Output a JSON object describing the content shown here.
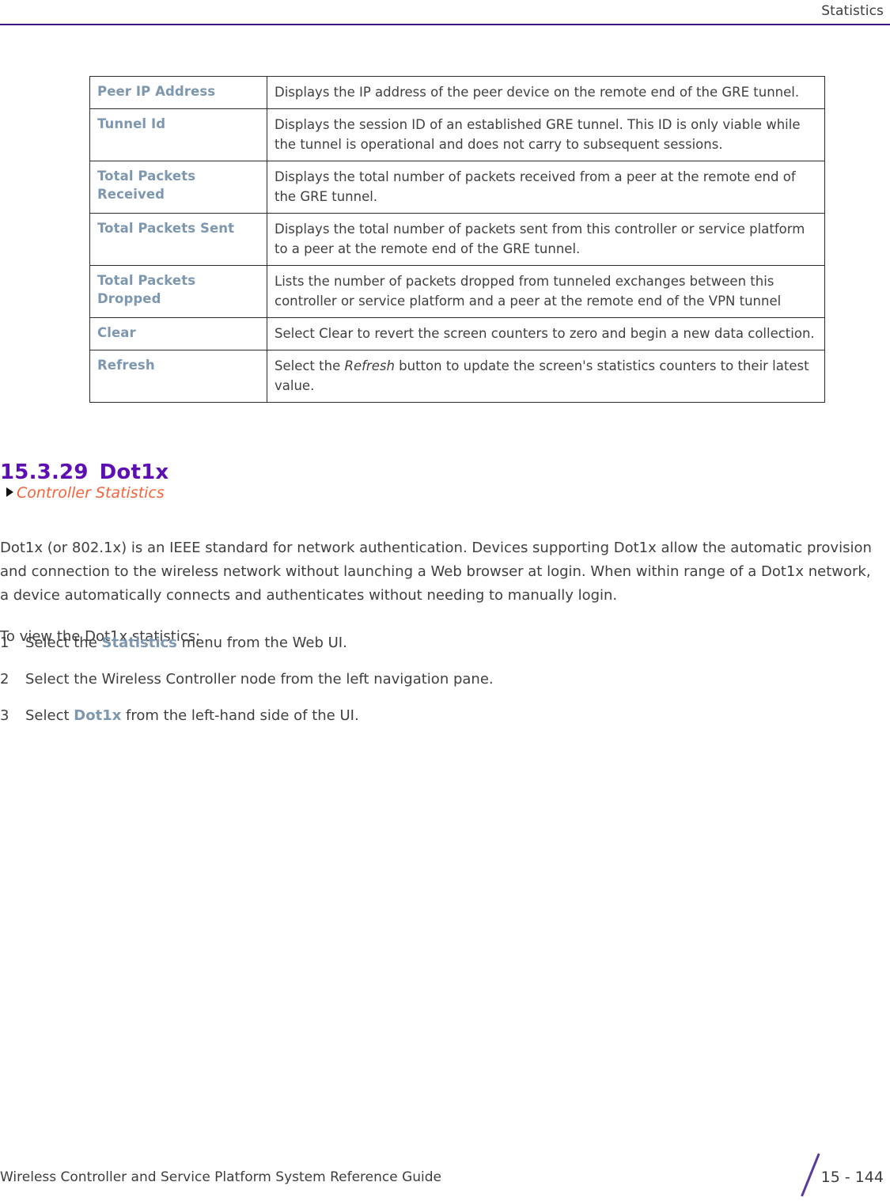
{
  "header": {
    "title": "Statistics",
    "rule_color": "#3c0f80"
  },
  "table": {
    "rows": [
      {
        "label": "Peer IP Address",
        "description": "Displays the IP address of the peer device on the remote end of the GRE tunnel."
      },
      {
        "label": "Tunnel Id",
        "description": "Displays the session ID of an established GRE tunnel. This ID is only viable while the tunnel is operational and does not carry to subsequent sessions."
      },
      {
        "label": "Total Packets Received",
        "description": "Displays the total number of packets received from a peer at the remote end of the GRE tunnel."
      },
      {
        "label": "Total Packets Sent",
        "description": "Displays the total number of packets sent from this controller or service platform to a peer at the remote end of the GRE tunnel."
      },
      {
        "label": "Total Packets Dropped",
        "description": "Lists the number of packets dropped from tunneled exchanges between this controller or service platform and a peer at the remote end of the VPN tunnel"
      },
      {
        "label": "Clear",
        "description": "Select Clear to revert the screen counters to zero and begin a new data collection."
      },
      {
        "label": "Refresh",
        "description_before": "Select the ",
        "description_italic": "Refresh",
        "description_after": " button to update the screen's statistics counters to their latest value."
      }
    ],
    "label_color": "#7d97b0"
  },
  "section": {
    "number": "15.3.29",
    "title": "Dot1x",
    "heading_color": "#5d0fb4"
  },
  "crossref": {
    "bullet_icon": "right-triangle-icon",
    "label": "Controller Statistics",
    "color": "#f4643c"
  },
  "body": {
    "intro_paragraph": "Dot1x (or 802.1x) is an IEEE standard for network authentication. Devices supporting Dot1x allow the automatic provision and connection to the wireless network without launching a Web browser at login. When within range of a Dot1x network, a device automatically connects and authenticates without needing to manually login.",
    "to_view_line": "To view the Dot1x statistics:"
  },
  "steps": [
    {
      "number": "1",
      "text_before": "Select the ",
      "bold": "Statistics",
      "text_after": " menu from the Web UI."
    },
    {
      "number": "2",
      "text_before": "Select the Wireless Controller node from the left navigation pane.",
      "bold": "",
      "text_after": ""
    },
    {
      "number": "3",
      "text_before": "Select ",
      "bold": "Dot1x",
      "text_after": " from the left-hand side of the UI."
    }
  ],
  "footer": {
    "guide_title": "Wireless Controller and Service Platform System Reference Guide",
    "page_number": "15 - 144",
    "slash_color": "#5b3a9e"
  }
}
